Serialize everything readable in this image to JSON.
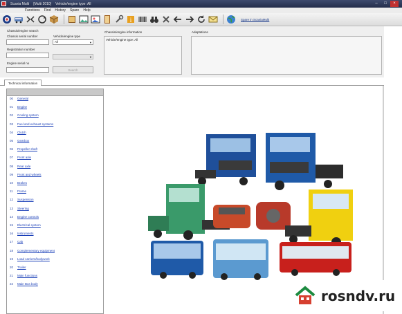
{
  "window": {
    "title_app": "Scania Multi",
    "title_version": "[Multi 2010]",
    "title_filter": "Vehicle/engine type: All",
    "controls": [
      "–",
      "□",
      "×"
    ]
  },
  "menu": [
    "Functions",
    "Find",
    "History",
    "Spare",
    "Help"
  ],
  "toolbar": {
    "icons": [
      "scania-logo-icon",
      "bus-icon",
      "compress-icon",
      "sync-icon",
      "cube-icon",
      "book-icon",
      "image-icon",
      "picture-icon",
      "book-icon",
      "wrench-icon",
      "info-icon",
      "barcode-icon",
      "binoculars-icon",
      "tools-icon",
      "back-arrow-icon",
      "forward-arrow-icon",
      "refresh-icon",
      "envelope-icon",
      "globe-icon"
    ],
    "link": "Spare in ScaniaMulti"
  },
  "search": {
    "group_title": "Chassis/engine search",
    "chassis_label": "Chassis serial number",
    "chassis_value": "",
    "vehicle_type_label": "Vehicle/engine type",
    "vehicle_type_value": "All",
    "registration_label": "Registration number",
    "registration_value": "",
    "engine_label": "Engine serial no",
    "engine_value": "",
    "search_button": "Search"
  },
  "chassis_info": {
    "title": "Chassis/engine information",
    "text": "Vehicle/engine type: All"
  },
  "adaptations": {
    "title": "Adaptations",
    "text": ""
  },
  "tabs": [
    {
      "label": "Technical information"
    }
  ],
  "list": [
    {
      "code": "00",
      "label": "General"
    },
    {
      "code": "01",
      "label": "Engine"
    },
    {
      "code": "02",
      "label": "Cooling system"
    },
    {
      "code": "03",
      "label": "Fuel and exhaust systems"
    },
    {
      "code": "04",
      "label": "Clutch"
    },
    {
      "code": "05",
      "label": "Gearbox"
    },
    {
      "code": "06",
      "label": "Propeller shaft"
    },
    {
      "code": "07",
      "label": "Front axle"
    },
    {
      "code": "08",
      "label": "Rear axle"
    },
    {
      "code": "09",
      "label": "Front and wheels"
    },
    {
      "code": "10",
      "label": "Brakes"
    },
    {
      "code": "11",
      "label": "Frame"
    },
    {
      "code": "12",
      "label": "Suspension"
    },
    {
      "code": "13",
      "label": "Steering"
    },
    {
      "code": "14",
      "label": "Engine controls"
    },
    {
      "code": "15",
      "label": "Electrical system"
    },
    {
      "code": "16",
      "label": "Instruments"
    },
    {
      "code": "17",
      "label": "Cab"
    },
    {
      "code": "18",
      "label": "Complementary equipment"
    },
    {
      "code": "19",
      "label": "Load carriers/bodywork"
    },
    {
      "code": "20",
      "label": "Trailer"
    },
    {
      "code": "21",
      "label": "Main functions"
    },
    {
      "code": "22",
      "label": "Main Bus body"
    }
  ],
  "watermark": {
    "text": "rosndv.ru",
    "colors": {
      "roof": "#1c8a3f",
      "house": "#d64030"
    }
  },
  "colors": {
    "titlebar": "#2d3858",
    "link": "#1a3fb8",
    "truck_blue": "#1f4f9a",
    "truck_green": "#3a9a6a",
    "truck_yellow": "#f0d010",
    "bus_red": "#c8201c",
    "bus_lightblue": "#5b9ad0"
  }
}
